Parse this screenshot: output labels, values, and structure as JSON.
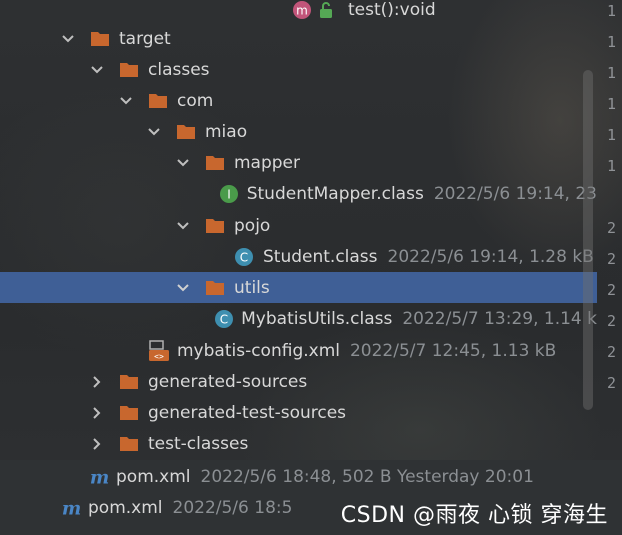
{
  "top_row": {
    "label": "test():void"
  },
  "tree": [
    {
      "label": "target",
      "meta": ""
    },
    {
      "label": "classes",
      "meta": ""
    },
    {
      "label": "com",
      "meta": ""
    },
    {
      "label": "miao",
      "meta": ""
    },
    {
      "label": "mapper",
      "meta": ""
    },
    {
      "label": "StudentMapper.class",
      "meta": "2022/5/6 19:14, 23"
    },
    {
      "label": "pojo",
      "meta": ""
    },
    {
      "label": "Student.class",
      "meta": "2022/5/6 19:14, 1.28 kB"
    },
    {
      "label": "utils",
      "meta": ""
    },
    {
      "label": "MybatisUtils.class",
      "meta": "2022/5/7 13:29, 1.14 k"
    },
    {
      "label": "mybatis-config.xml",
      "meta": "2022/5/7 12:45, 1.13 kB"
    },
    {
      "label": "generated-sources",
      "meta": ""
    },
    {
      "label": "generated-test-sources",
      "meta": ""
    },
    {
      "label": "test-classes",
      "meta": ""
    }
  ],
  "bottom_rows": [
    {
      "label": "pom.xml",
      "meta": "2022/5/6 18:48, 502 B Yesterday 20:01"
    },
    {
      "label": "pom.xml",
      "meta": "2022/5/6 18:5"
    }
  ],
  "line_numbers": [
    "1",
    "1",
    "1",
    "1",
    "1",
    "1",
    "2",
    "2",
    "2",
    "2",
    "2",
    "2"
  ],
  "watermark": "CSDN @雨夜 心锁 穿海生",
  "colors": {
    "selection": "#3f5f96",
    "folder": "#c8672e",
    "interface": "#4a9b4a",
    "class": "#3e8fb0",
    "maven": "#4a86c6"
  }
}
